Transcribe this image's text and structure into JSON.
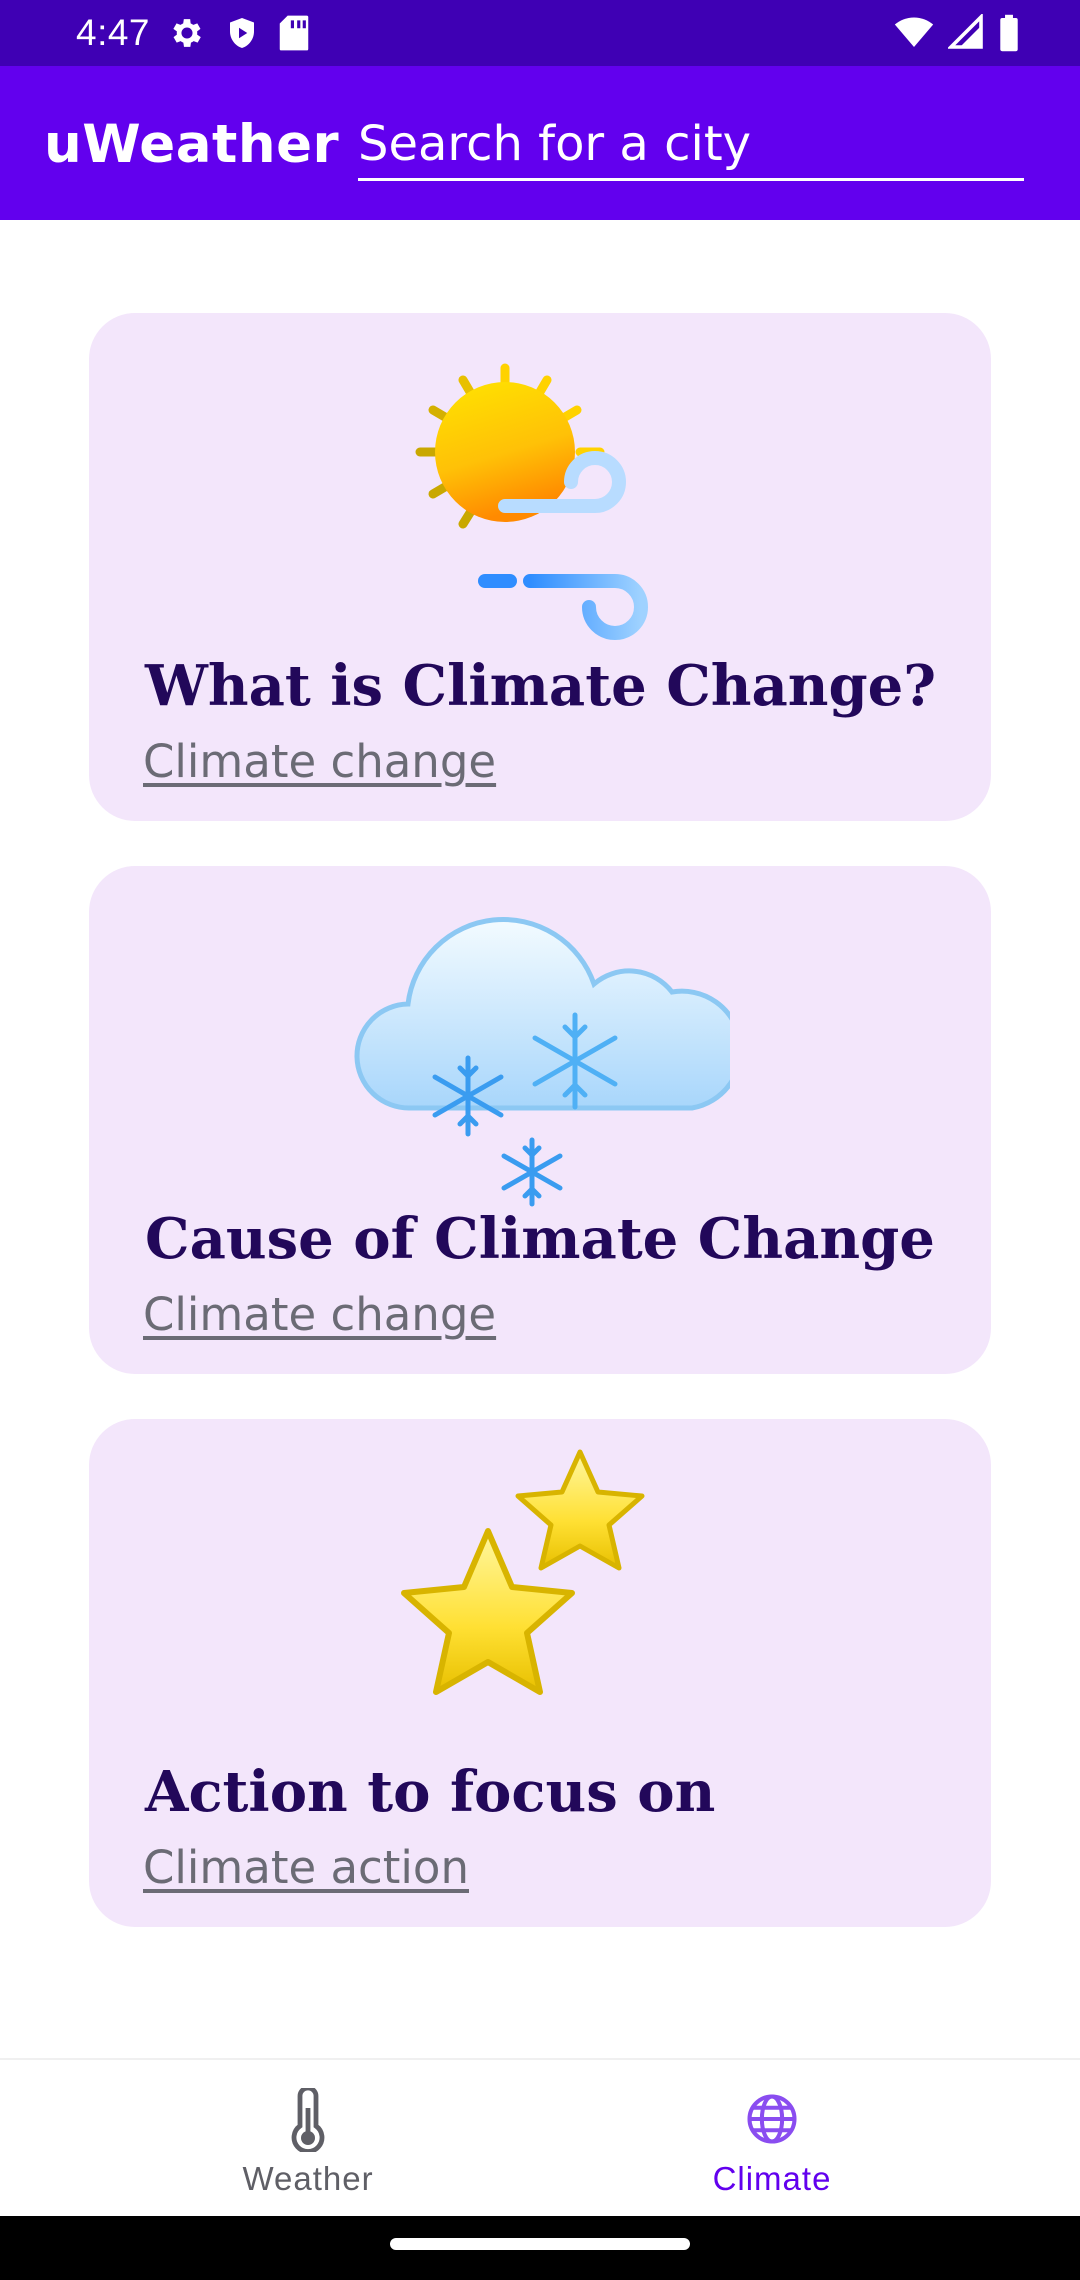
{
  "status_bar": {
    "time": "4:47",
    "left_icons": [
      "gear-icon",
      "shield-play-icon",
      "sd-card-icon"
    ],
    "right_icons": [
      "wifi-icon",
      "signal-icon",
      "battery-icon"
    ]
  },
  "app_bar": {
    "title": "uWeather",
    "search_placeholder": "Search for a city",
    "background_color": "#6200ee"
  },
  "cards": [
    {
      "title": "What is Climate Change?",
      "link": "Climate change",
      "icon": "sun-wind-icon"
    },
    {
      "title": "Cause of Climate Change",
      "link": "Climate change",
      "icon": "snow-cloud-icon"
    },
    {
      "title": "Action to focus on",
      "link": "Climate action",
      "icon": "stars-icon"
    }
  ],
  "bottom_nav": {
    "items": [
      {
        "label": "Weather",
        "icon": "thermometer-icon",
        "selected": false
      },
      {
        "label": "Climate",
        "icon": "globe-icon",
        "selected": true
      }
    ],
    "selected_color": "#6200ee",
    "unselected_color": "#5f5f66"
  }
}
